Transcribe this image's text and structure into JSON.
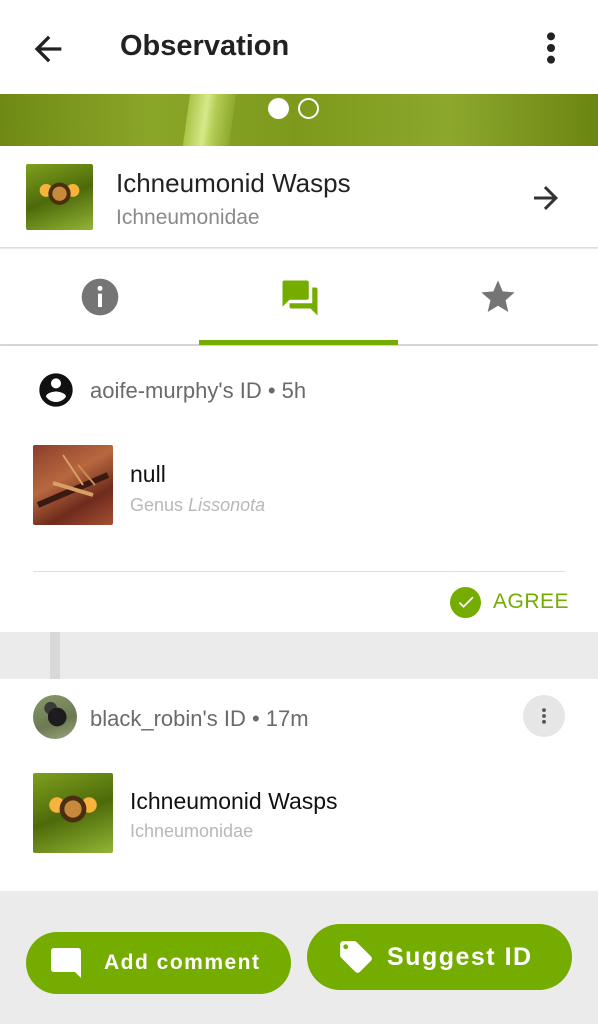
{
  "appbar": {
    "title": "Observation",
    "back_icon": "arrow-back-icon",
    "menu_icon": "more-vert-icon"
  },
  "photo": {
    "pager_total": 2,
    "pager_active": 1
  },
  "taxon": {
    "name": "Ichneumonid Wasps",
    "scientific": "Ichneumonidae",
    "arrow_icon": "arrow-forward-icon"
  },
  "tabs": [
    {
      "icon": "info-icon",
      "active": false
    },
    {
      "icon": "chat-icon",
      "active": true
    },
    {
      "icon": "star-icon",
      "active": false
    }
  ],
  "identifications": [
    {
      "header": "aoife-murphy's ID • 5h",
      "avatar": "account-circle-icon",
      "name": "null",
      "rank": "Genus",
      "scientific": "Lissonota",
      "agree_label": "AGREE"
    },
    {
      "header": "black_robin's ID • 17m",
      "avatar": "bird-avatar",
      "name": "Ichneumonid Wasps",
      "scientific": "Ichneumonidae"
    }
  ],
  "actions": {
    "add_comment": "Add comment",
    "suggest_id": "Suggest ID"
  },
  "colors": {
    "accent": "#74ac00",
    "muted_text": "#8a8a8a"
  }
}
